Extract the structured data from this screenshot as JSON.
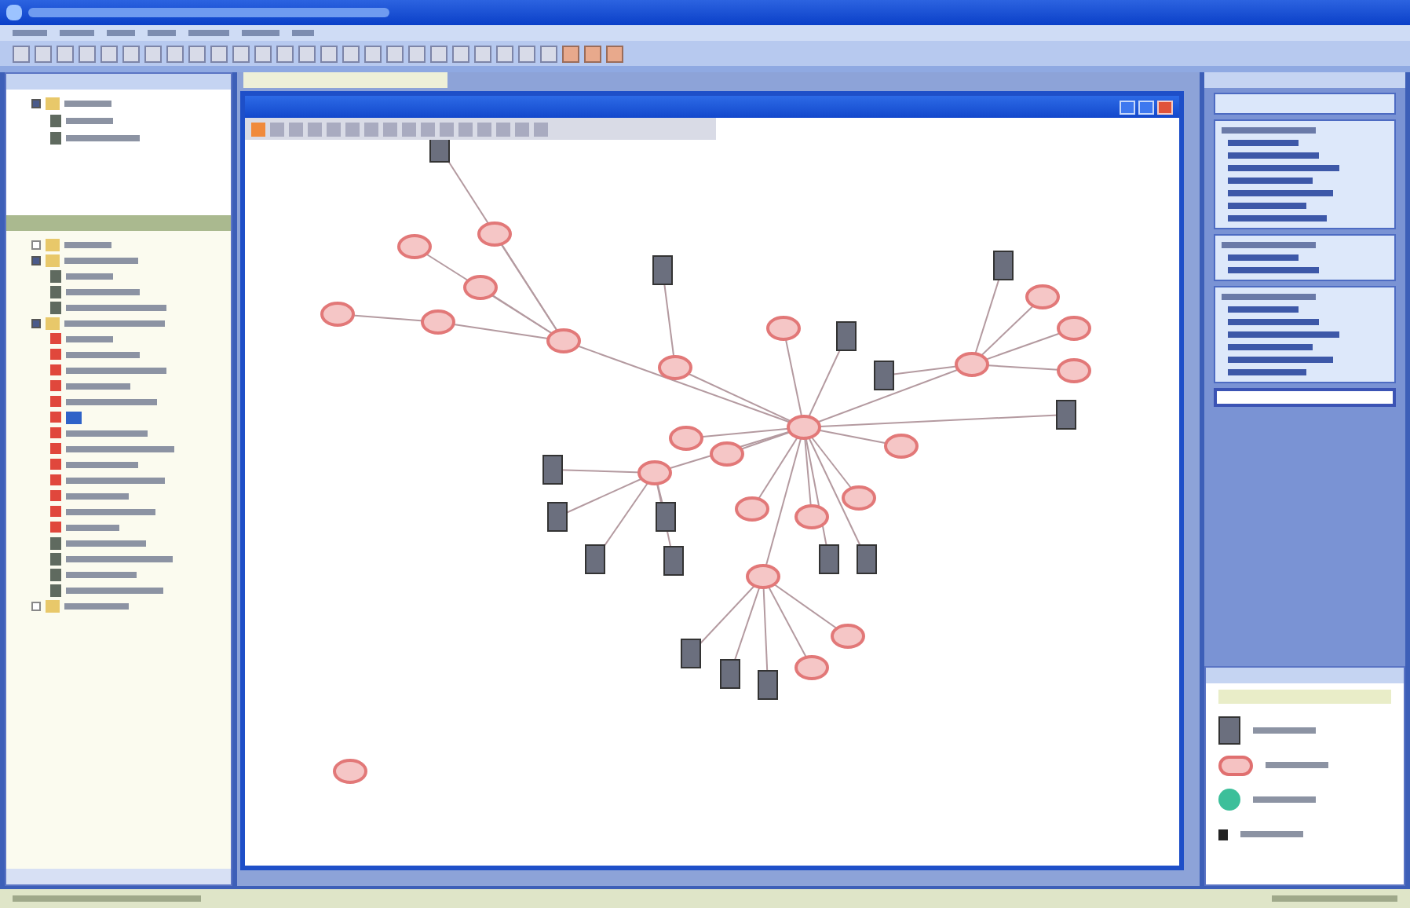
{
  "tree_top": [
    {
      "kind": "folder",
      "expanded": true,
      "children": [
        {
          "kind": "document"
        },
        {
          "kind": "document"
        }
      ]
    }
  ],
  "tree_main": [
    {
      "kind": "folder",
      "expanded": false
    },
    {
      "kind": "folder",
      "expanded": true,
      "children": [
        {
          "kind": "document"
        },
        {
          "kind": "document"
        },
        {
          "kind": "document"
        }
      ]
    },
    {
      "kind": "folder",
      "expanded": true,
      "children": [
        {
          "kind": "entity",
          "selected": false
        },
        {
          "kind": "entity",
          "selected": false
        },
        {
          "kind": "entity",
          "selected": false
        },
        {
          "kind": "entity",
          "selected": false
        },
        {
          "kind": "entity",
          "selected": false
        },
        {
          "kind": "entity",
          "selected": true
        },
        {
          "kind": "entity",
          "selected": false
        },
        {
          "kind": "entity",
          "selected": false
        },
        {
          "kind": "entity",
          "selected": false
        },
        {
          "kind": "entity",
          "selected": false
        },
        {
          "kind": "entity",
          "selected": false
        },
        {
          "kind": "entity",
          "selected": false
        },
        {
          "kind": "entity",
          "selected": false
        },
        {
          "kind": "document",
          "selected": false
        },
        {
          "kind": "document",
          "selected": false
        },
        {
          "kind": "document",
          "selected": false
        },
        {
          "kind": "document",
          "selected": false
        }
      ]
    },
    {
      "kind": "folder",
      "expanded": false
    }
  ],
  "graph": {
    "nodes": [
      {
        "kind": "document"
      },
      {
        "kind": "document"
      },
      {
        "kind": "document"
      },
      {
        "kind": "document"
      },
      {
        "kind": "document"
      },
      {
        "kind": "document"
      },
      {
        "kind": "document"
      },
      {
        "kind": "document"
      },
      {
        "kind": "document"
      },
      {
        "kind": "document"
      },
      {
        "kind": "document"
      },
      {
        "kind": "document"
      },
      {
        "kind": "document"
      },
      {
        "kind": "document"
      },
      {
        "kind": "document"
      },
      {
        "kind": "document"
      },
      {
        "kind": "entity"
      },
      {
        "kind": "entity"
      },
      {
        "kind": "entity"
      },
      {
        "kind": "entity"
      },
      {
        "kind": "entity"
      },
      {
        "kind": "entity"
      },
      {
        "kind": "entity"
      },
      {
        "kind": "entity"
      },
      {
        "kind": "entity"
      },
      {
        "kind": "entity"
      },
      {
        "kind": "entity"
      },
      {
        "kind": "entity"
      },
      {
        "kind": "entity"
      },
      {
        "kind": "entity"
      },
      {
        "kind": "entity"
      },
      {
        "kind": "entity"
      },
      {
        "kind": "entity"
      },
      {
        "kind": "entity"
      },
      {
        "kind": "entity"
      },
      {
        "kind": "entity"
      },
      {
        "kind": "entity"
      },
      {
        "kind": "entity"
      },
      {
        "kind": "entity"
      },
      {
        "kind": "entity"
      }
    ]
  },
  "task_sections": [
    {
      "items": [
        {
          "kind": "link"
        },
        {
          "kind": "link"
        },
        {
          "kind": "link"
        },
        {
          "kind": "link"
        },
        {
          "kind": "link"
        },
        {
          "kind": "link"
        },
        {
          "kind": "link"
        }
      ]
    },
    {
      "items": [
        {
          "kind": "link"
        },
        {
          "kind": "link"
        }
      ]
    },
    {
      "items": [
        {
          "kind": "link"
        },
        {
          "kind": "link"
        },
        {
          "kind": "link"
        },
        {
          "kind": "link"
        },
        {
          "kind": "link"
        },
        {
          "kind": "link"
        }
      ]
    }
  ],
  "legend": [
    {
      "kind": "document"
    },
    {
      "kind": "entity"
    },
    {
      "kind": "group"
    },
    {
      "kind": "small"
    }
  ]
}
